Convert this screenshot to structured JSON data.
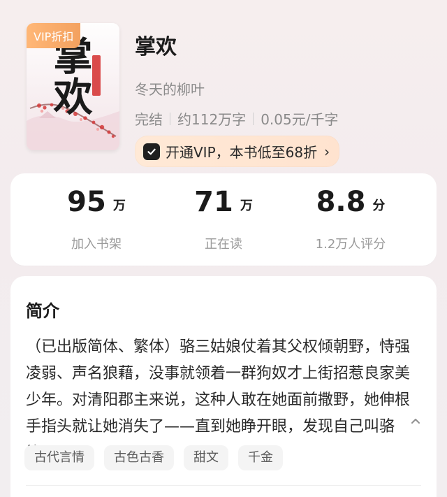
{
  "book": {
    "vip_badge": "VIP折扣",
    "cover_title": "掌欢",
    "title": "掌欢",
    "author": "冬天的柳叶",
    "status": "完结",
    "word_count": "约112万字",
    "price": "0.05元/千字",
    "vip_offer": "开通VIP，本书低至68折",
    "vip_offer_chevron": "›"
  },
  "stats": [
    {
      "value": "95",
      "unit": "万",
      "label": "加入书架"
    },
    {
      "value": "71",
      "unit": "万",
      "label": "正在读"
    },
    {
      "value": "8.8",
      "unit": "分",
      "label": "1.2万人评分"
    }
  ],
  "intro": {
    "title": "简介",
    "text": "（已出版简体、繁体）骆三姑娘仗着其父权倾朝野，恃强凌弱、声名狼藉，没事就领着一群狗奴才上街招惹良家美少年。对清阳郡主来说，这种人敢在她面前撒野，她伸根手指头就让她消失了——直到她睁开眼，发现自己叫骆笙。",
    "collapse_icon": "chevron-up-icon",
    "tags": [
      "古代言情",
      "古色古香",
      "甜文",
      "千金"
    ]
  },
  "colors": {
    "vip_badge_bg": "#f3a15f",
    "vip_pill_bg": "#ffe6d2",
    "cover_red": "#d42d2d"
  }
}
